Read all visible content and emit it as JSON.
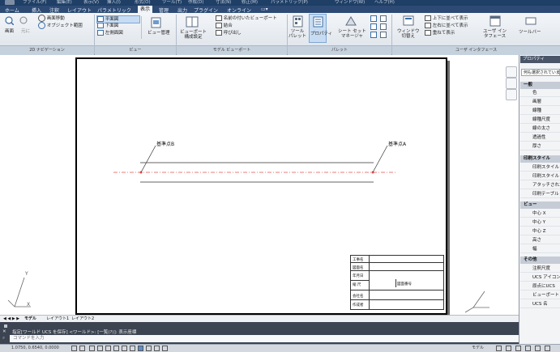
{
  "menu": {
    "items": [
      "ファイル(F)",
      "編集(E)",
      "表示(V)",
      "挿入(I)",
      "形式(O)",
      "ツール(T)",
      "作成(D)",
      "寸法(N)",
      "修正(M)",
      "パラメトリック(P)",
      "ウィンドウ(W)",
      "ヘルプ(H)"
    ]
  },
  "tabs": {
    "items": [
      "ホーム",
      "挿入",
      "注釈",
      "レイアウト",
      "パラメトリック",
      "表示",
      "管理",
      "出力",
      "プラグイン",
      "オンライン",
      "▭▾"
    ],
    "active": "表示"
  },
  "ribbon": {
    "panels": [
      "2D ナビゲーション",
      "ビュー",
      "モデル ビューポート",
      "パレット",
      "ユーザ インタフェース"
    ],
    "nav_pan": "画面移動",
    "nav_extents": "オブジェクト範囲",
    "nav_zoom": "画面",
    "nav_back": "元に",
    "view_top": "平面図",
    "view_bottom": "下面図",
    "view_left": "左側面図",
    "view_manager": "ビュー管理",
    "vp_config": "ビューポート\n構成設定",
    "vp_named": "名前の付いたビューポート",
    "vp_join": "結合",
    "vp_restore": "呼び出し",
    "pal_tool": "ツール\nパレット",
    "pal_props": "プロパティ",
    "pal_sheetset": "シート セット\nマネージャ",
    "ui_switch": "ウィンドウ\n切替え",
    "ui_tile_h": "上下に並べて表示",
    "ui_tile_v": "左右に並べて表示",
    "ui_cascade": "重ねて表示",
    "ui_interface": "ユーザ イン\nタフェース",
    "ui_toolbars": "ツールバー"
  },
  "drawing": {
    "label_b": "基準点B",
    "label_a": "基準点A",
    "title_block": [
      [
        "工事名",
        ""
      ],
      [
        "図面名",
        ""
      ],
      [
        "年月日",
        ""
      ],
      [
        "縮 尺",
        "図面番号"
      ],
      [
        "会社名",
        ""
      ],
      [
        "作成者",
        ""
      ]
    ]
  },
  "ucs": {
    "x": "X",
    "y": "Y"
  },
  "layout_tabs": [
    "モデル",
    "レイアウト1",
    "レイアウト2"
  ],
  "command": {
    "history": "指定[ワールド UCS を保存] <ワールド>: [一覧(?)]: 表示座標",
    "prompt": "コマンドを入力"
  },
  "status": {
    "coords": "1.0750, 0.6540, 0.0000",
    "right": "モデル"
  },
  "palette": {
    "title": "プロパティ",
    "selection": "何も選択されていません",
    "categories": [
      {
        "name": "一般",
        "rows": [
          "色",
          "画層",
          "線種",
          "線種尺度",
          "線の太さ",
          "透過性",
          "厚さ"
        ]
      },
      {
        "name": "印刷スタイル",
        "rows": [
          "印刷スタイル",
          "印刷スタイル",
          "アタッチされた",
          "印刷テーブル"
        ]
      },
      {
        "name": "ビュー",
        "rows": [
          "中心 X",
          "中心 Y",
          "中心 Z",
          "高さ",
          "幅"
        ]
      },
      {
        "name": "その他",
        "rows": [
          "注釈尺度",
          "UCS アイコン",
          "原点にUCS",
          "ビューポート",
          "UCS 名"
        ]
      }
    ]
  },
  "colors": {
    "accent": "#3b6ea5",
    "red_axis": "#e05050",
    "ribbon_bg": "#e8ecf1"
  }
}
